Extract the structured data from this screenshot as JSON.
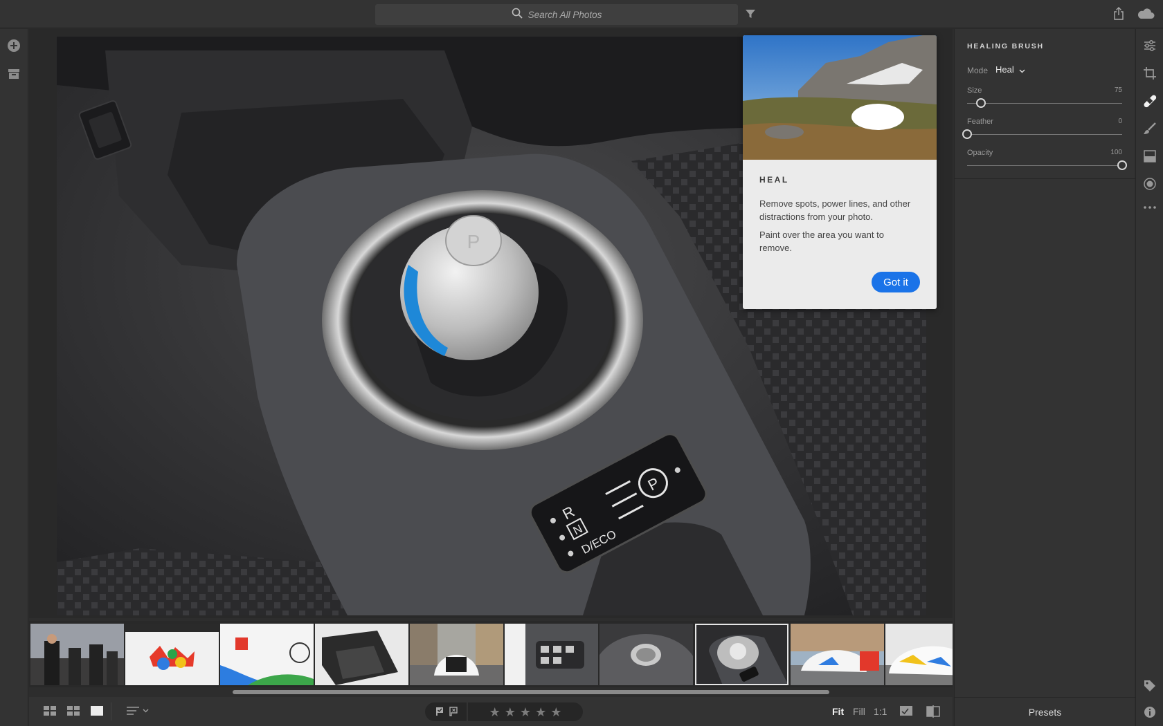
{
  "search": {
    "placeholder": "Search All Photos"
  },
  "panel": {
    "title": "HEALING BRUSH",
    "mode_label": "Mode",
    "mode_value": "Heal",
    "sliders": [
      {
        "label": "Size",
        "value": "75",
        "fraction": 0.09
      },
      {
        "label": "Feather",
        "value": "0",
        "fraction": 0.0
      },
      {
        "label": "Opacity",
        "value": "100",
        "fraction": 1.0
      }
    ],
    "presets_label": "Presets"
  },
  "callout": {
    "title": "HEAL",
    "paragraph1": "Remove spots, power lines, and other distractions from your photo.",
    "paragraph2": "Paint over the area you want to remove.",
    "button": "Got it"
  },
  "filmstrip": {
    "count": 10,
    "selected_index": 7
  },
  "bottombar": {
    "zoom_options": [
      "Fit",
      "Fill",
      "1:1"
    ],
    "active_zoom": "Fit",
    "stars": [
      "★",
      "★",
      "★",
      "★",
      "★"
    ]
  },
  "colors": {
    "accent": "#1a73e8",
    "panel_bg": "#333333",
    "canvas_bg": "#292929"
  }
}
